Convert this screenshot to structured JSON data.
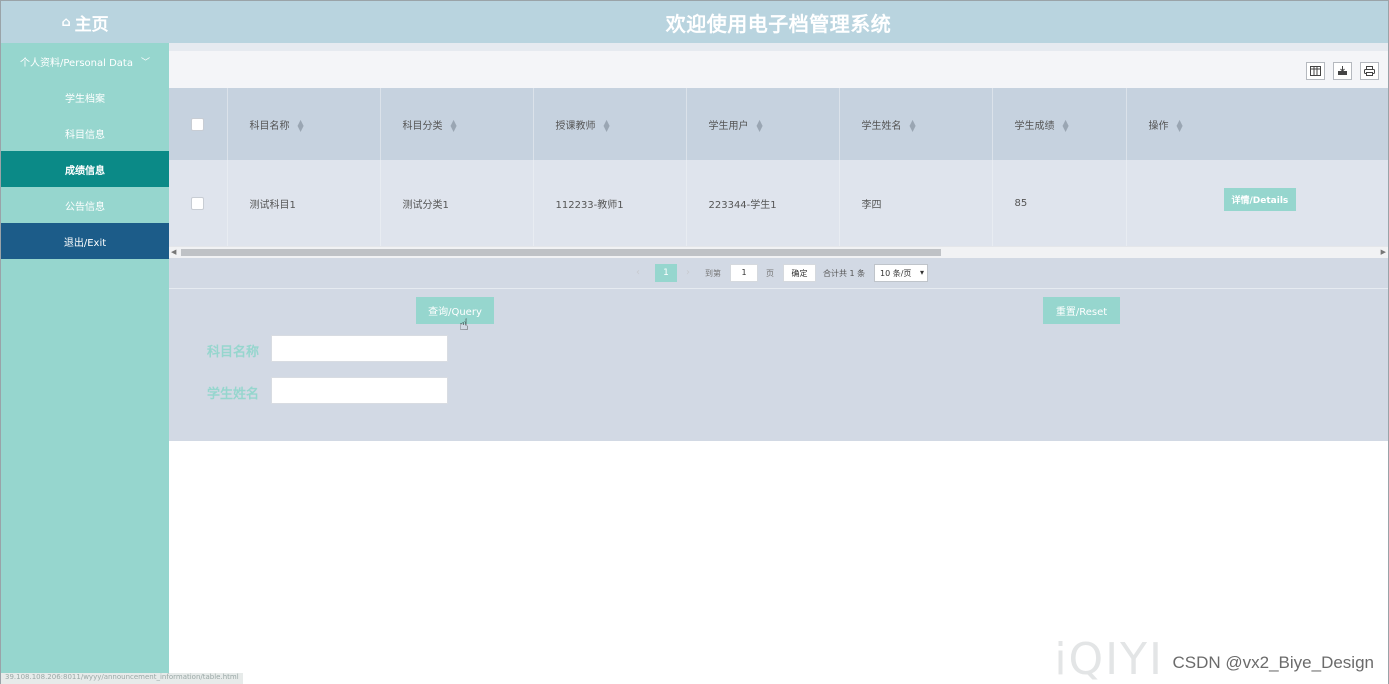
{
  "header": {
    "home_label": "主页",
    "home_icon": "house-outline-icon",
    "title": "欢迎使用电子档管理系统"
  },
  "sidebar": {
    "group_label": "个人资料/Personal Data",
    "items": [
      {
        "label": "学生档案",
        "active": false
      },
      {
        "label": "科目信息",
        "active": false
      },
      {
        "label": "成绩信息",
        "active": true
      },
      {
        "label": "公告信息",
        "active": false
      }
    ],
    "exit_label": "退出/Exit"
  },
  "toolbar": {
    "icons": [
      "columns-icon",
      "export-icon",
      "print-icon"
    ]
  },
  "table": {
    "columns": [
      "科目名称",
      "科目分类",
      "授课教师",
      "学生用户",
      "学生姓名",
      "学生成绩",
      "操作"
    ],
    "rows": [
      {
        "subject_name": "测试科目1",
        "subject_category": "测试分类1",
        "teacher": "112233-教师1",
        "student_user": "223344-学生1",
        "student_name": "李四",
        "score": "85",
        "action_label": "详情/Details"
      }
    ]
  },
  "pagination": {
    "current_page": "1",
    "goto_label": "到第",
    "goto_value": "1",
    "page_suffix": "页",
    "confirm_label": "确定",
    "total_text": "合计共 1 条",
    "page_size": "10 条/页"
  },
  "search": {
    "query_label": "查询/Query",
    "reset_label": "重置/Reset",
    "fields": [
      {
        "label": "科目名称",
        "value": ""
      },
      {
        "label": "学生姓名",
        "value": ""
      }
    ]
  },
  "colors": {
    "header_bg": "#b9d4df",
    "sidebar_bg": "#96d6ce",
    "sidebar_active": "#0b8a87",
    "sidebar_exit": "#1c5c89",
    "accent": "#96d6ce"
  },
  "overlay": {
    "status_url": "39.108.108.206:8011/wyyy/announcement_information/table.html",
    "watermark": "CSDN @vx2_Biye_Design",
    "video_logo": "iQIYI"
  }
}
